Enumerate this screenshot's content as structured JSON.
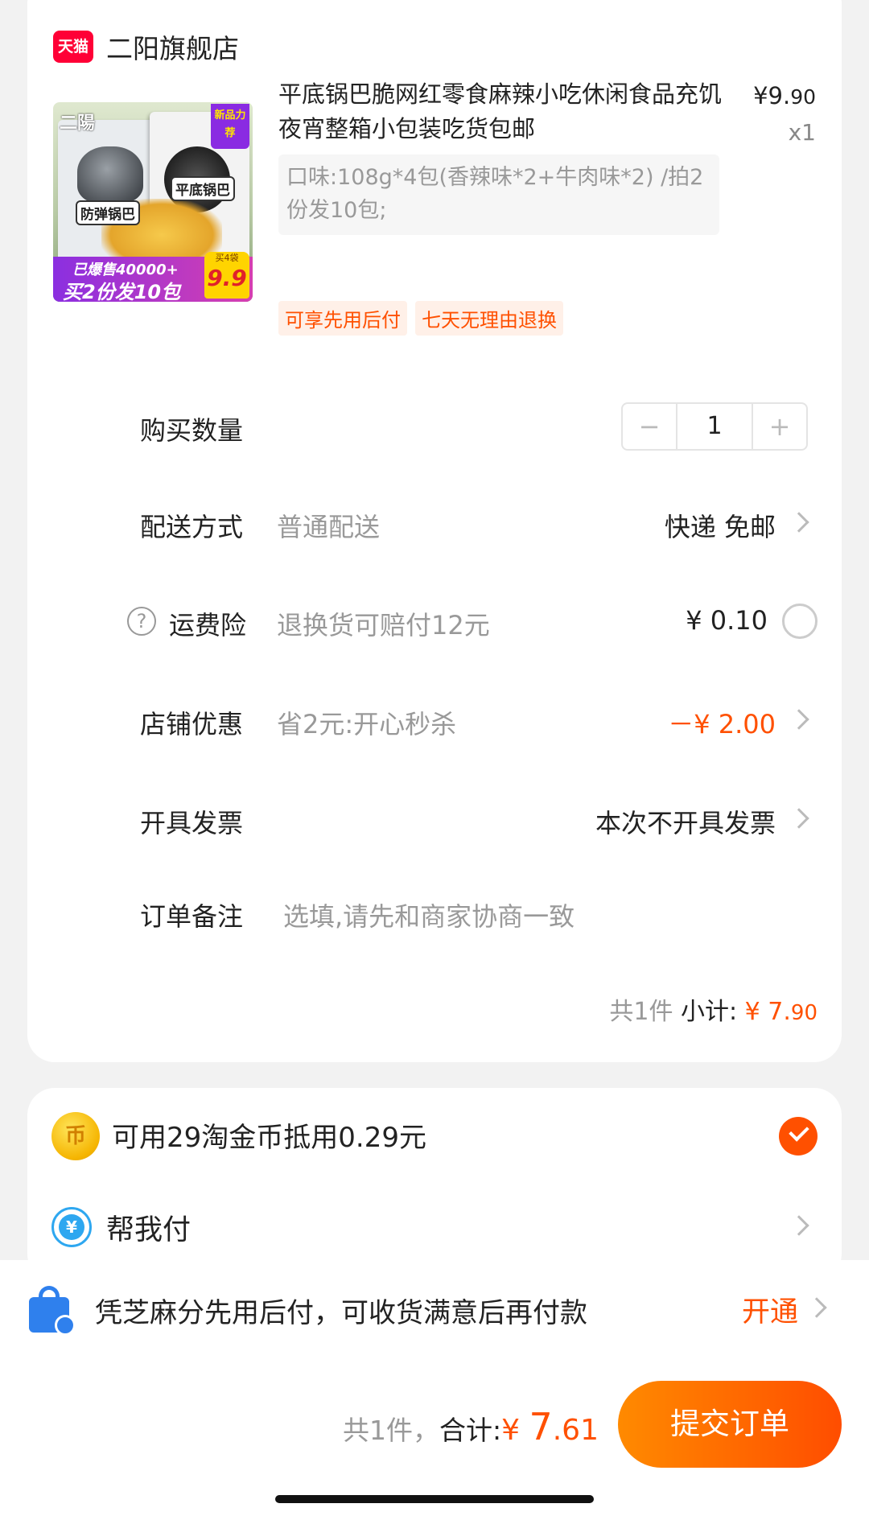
{
  "store": {
    "badge": "天猫",
    "name": "二阳旗舰店"
  },
  "product": {
    "title": "平底锅巴脆网红零食麻辣小吃休闲食品充饥夜宵整箱小包装吃货包邮",
    "price_symbol": "¥",
    "price_int": "9.",
    "price_cents": "90",
    "quantity_label": "x1",
    "sku": "口味:108g*4包(香辣味*2+牛肉味*2) /拍2份发10包;",
    "image": {
      "brand": "二陽",
      "new_badge": "新品力荐",
      "bag_label_1": "防弹锅巴",
      "bag_label_2": "平底锅巴",
      "sold": "已爆售40000+",
      "promo": "买2份发10包",
      "price_top": "买4袋",
      "price_val": "9.9"
    },
    "tags": [
      "可享先用后付",
      "七天无理由退换"
    ]
  },
  "rows": {
    "quantity": {
      "label": "购买数量",
      "minus": "−",
      "value": "1",
      "plus": "+"
    },
    "delivery": {
      "label": "配送方式",
      "sub": "普通配送",
      "value": "快递 免邮"
    },
    "insurance": {
      "help": "?",
      "label": "运费险",
      "sub": "退换货可赔付12元",
      "value": "¥ 0.10"
    },
    "discount": {
      "label": "店铺优惠",
      "sub": "省2元:开心秒杀",
      "value": "－¥ 2.00"
    },
    "invoice": {
      "label": "开具发票",
      "value": "本次不开具发票"
    },
    "remark": {
      "label": "订单备注",
      "placeholder": "选填,请先和商家协商一致"
    }
  },
  "subtotal": {
    "count": "共1件",
    "label": " 小计: ",
    "symbol": "¥",
    "amount": "7.",
    "cents": "90"
  },
  "coins": {
    "icon": "币",
    "text": "可用29淘金币抵用0.29元",
    "checked": true
  },
  "help_pay": {
    "icon": "¥",
    "text": "帮我付"
  },
  "zhima": {
    "text": "凭芝麻分先用后付，可收货满意后再付款",
    "link": "开通"
  },
  "total": {
    "count": "共1件，",
    "label": "合计:",
    "symbol": "¥ ",
    "amount": "7",
    "cents": ".61"
  },
  "submit": {
    "label": "提交订单"
  },
  "colors": {
    "accent": "#ff5000",
    "tmall": "#ff0036"
  }
}
